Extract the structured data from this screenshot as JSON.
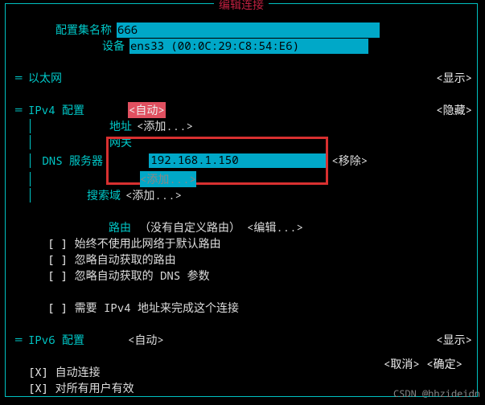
{
  "title": "编辑连接",
  "profile": {
    "name_label": "配置集名称",
    "name_value": "666",
    "device_label": "设备",
    "device_value": "ens33 (00:0C:29:C8:54:E6)"
  },
  "ethernet": {
    "heading": "以太网",
    "btn": "<显示>"
  },
  "ipv4": {
    "heading": "IPv4 配置",
    "mode": "<自动>",
    "btn": "<隐藏>",
    "addr_label": "地址",
    "addr_add": "<添加...>",
    "gw_label": "网关",
    "dns_label": "DNS 服务器",
    "dns_value": "192.168.1.150",
    "dns_remove": "<移除>",
    "dns_add": "<添加...>",
    "search_label": "搜索域",
    "search_add": "<添加...>",
    "route_label": "路由",
    "route_text": "（没有自定义路由）",
    "route_edit": "<编辑...>",
    "cb1": "始终不使用此网络于默认路由",
    "cb2": "忽略自动获取的路由",
    "cb3": "忽略自动获取的 DNS 参数",
    "cb4": "需要 IPv4 地址来完成这个连接"
  },
  "ipv6": {
    "heading": "IPv6 配置",
    "mode": "<自动>",
    "btn": "<显示>"
  },
  "conn": {
    "cb1": "自动连接",
    "cb2": "对所有用户有效"
  },
  "actions": {
    "cancel": "<取消>",
    "ok": "<确定>"
  },
  "footer": "CSDN @hhzideidn"
}
